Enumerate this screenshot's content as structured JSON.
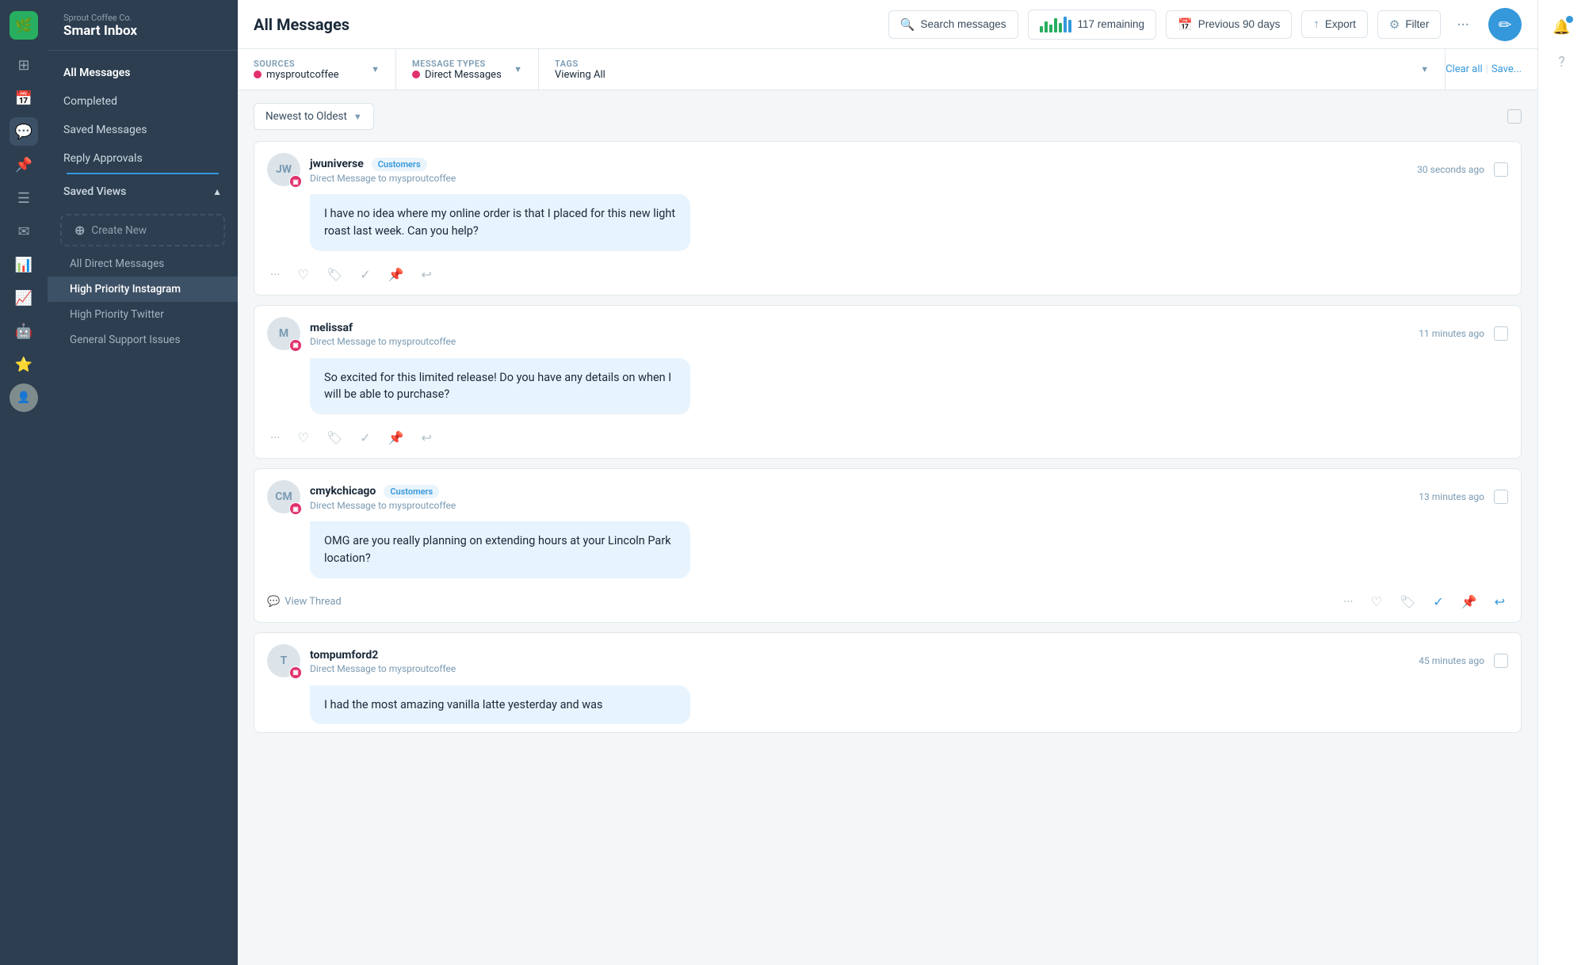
{
  "brand": {
    "company": "Sprout Coffee Co.",
    "product": "Smart Inbox"
  },
  "nav": {
    "all_messages": "All Messages",
    "completed": "Completed",
    "saved_messages": "Saved Messages",
    "reply_approvals": "Reply Approvals",
    "saved_views": "Saved Views"
  },
  "saved_views": {
    "create_new": "Create New",
    "items": [
      {
        "label": "All Direct Messages",
        "active": false
      },
      {
        "label": "High Priority Instagram",
        "active": true
      },
      {
        "label": "High Priority Twitter",
        "active": false
      },
      {
        "label": "General Support Issues",
        "active": false
      }
    ]
  },
  "header": {
    "title": "All Messages",
    "search_placeholder": "Search messages",
    "remaining": "117 remaining",
    "period": "Previous 90 days",
    "export": "Export",
    "filter": "Filter"
  },
  "filters": {
    "sources_label": "Sources",
    "sources_value": "mysproutcoffee",
    "message_types_label": "Message Types",
    "message_types_value": "Direct Messages",
    "tags_label": "Tags",
    "tags_value": "Viewing All",
    "clear": "Clear all",
    "save": "Save..."
  },
  "sort": {
    "value": "Newest to Oldest"
  },
  "messages": [
    {
      "id": 1,
      "username": "jwuniverse",
      "tag": "Customers",
      "sub": "Direct Message to mysproutcoffee",
      "time": "30 seconds ago",
      "avatar_initials": "JW",
      "bubble": "I have no idea where my online order is that I placed for this new light roast last week. Can you help?",
      "has_view_thread": false,
      "check_active": false,
      "reply_active": false
    },
    {
      "id": 2,
      "username": "melissaf",
      "tag": "",
      "sub": "Direct Message to mysproutcoffee",
      "time": "11 minutes ago",
      "avatar_initials": "M",
      "bubble": "So excited for this limited release! Do you have any details on when I will be able to purchase?",
      "has_view_thread": false,
      "check_active": false,
      "reply_active": false
    },
    {
      "id": 3,
      "username": "cmykchicago",
      "tag": "Customers",
      "sub": "Direct Message to mysproutcoffee",
      "time": "13 minutes ago",
      "avatar_initials": "CM",
      "bubble": "OMG are you really planning on extending hours at your Lincoln Park location?",
      "has_view_thread": true,
      "view_thread_label": "View Thread",
      "check_active": true,
      "reply_active": true
    },
    {
      "id": 4,
      "username": "tompumford2",
      "tag": "",
      "sub": "Direct Message to mysproutcoffee",
      "time": "45 minutes ago",
      "avatar_initials": "T",
      "bubble": "I had the most amazing vanilla latte yesterday and was",
      "has_view_thread": false,
      "check_active": false,
      "reply_active": false
    }
  ],
  "bar_chart_heights": [
    8,
    14,
    10,
    18,
    12,
    20,
    16
  ]
}
